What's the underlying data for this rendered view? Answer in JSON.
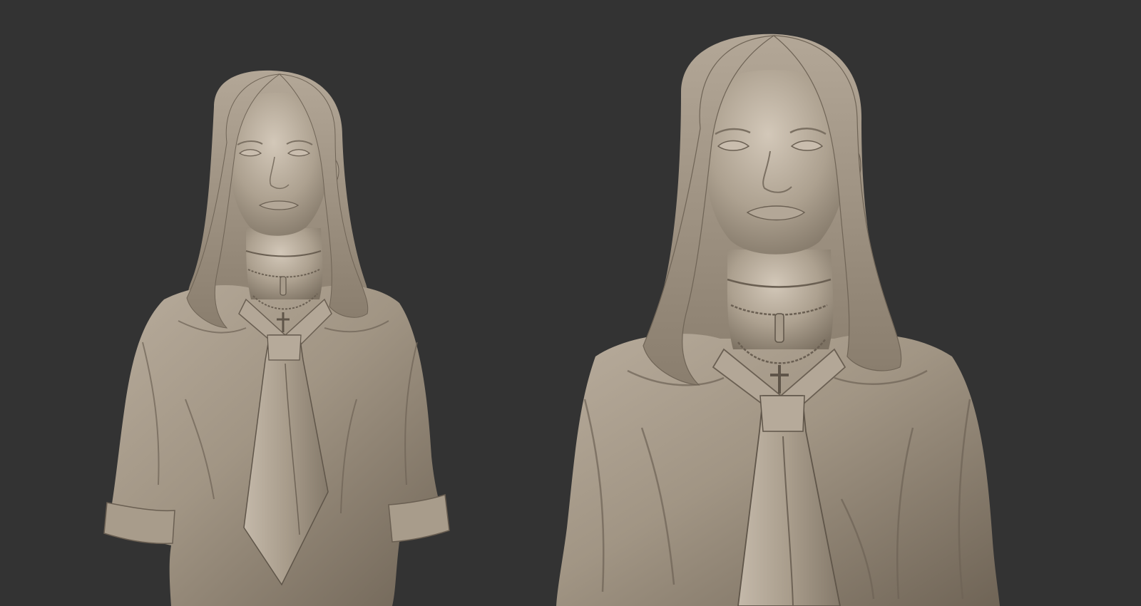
{
  "scene": {
    "background_color": "#333333",
    "clay_color": "#9f9282",
    "clay_highlight": "#cfc4b5",
    "clay_shadow": "#5e5448",
    "render_count": 2,
    "renders": [
      {
        "view": "bust-front-far"
      },
      {
        "view": "bust-front-close"
      }
    ]
  }
}
